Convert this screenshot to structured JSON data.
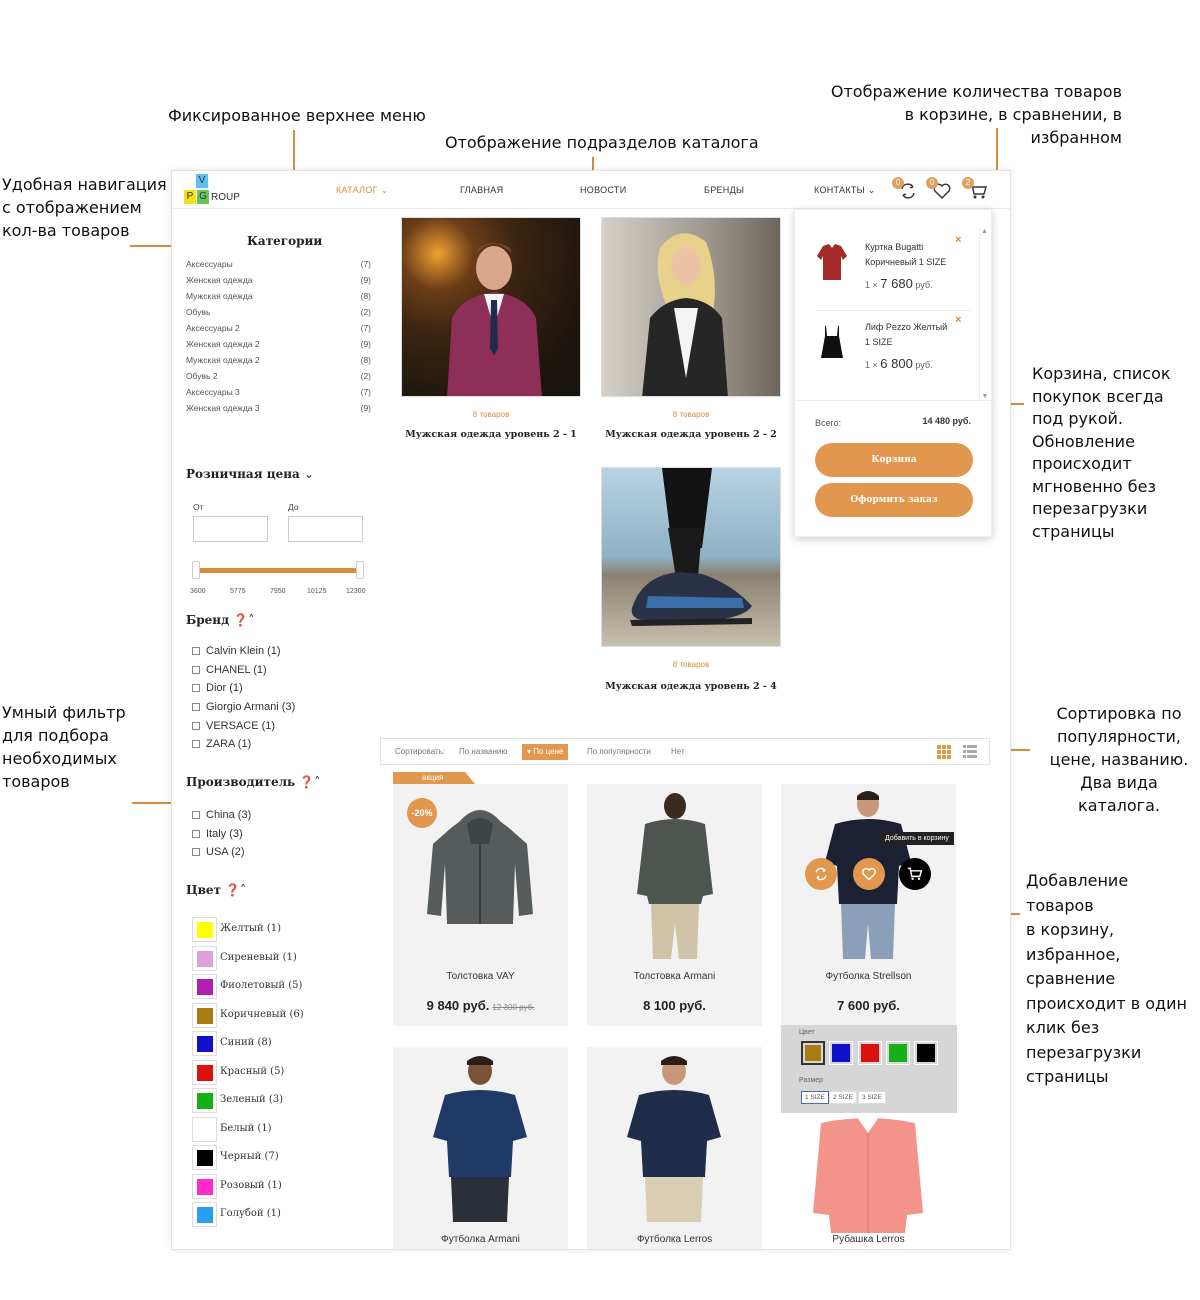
{
  "annotations": {
    "fixed_menu": "Фиксированное верхнее меню",
    "subsections": "Отображение подразделов каталога",
    "counters": [
      "Отображение количества товаров",
      "в корзине, в сравнении, в избранном"
    ],
    "navigation": [
      "Удобная навигация",
      "с отображением",
      "кол-ва товаров"
    ],
    "cart": [
      "Корзина, список",
      "покупок всегда",
      "под рукой.",
      "Обновление",
      "происходит",
      "мгновенно без",
      "перезагрузки",
      "страницы"
    ],
    "smart_filter": [
      "Умный фильтр",
      "для подбора",
      "необходимых",
      "товаров"
    ],
    "sorting": [
      "Сортировка по",
      "популярности,",
      "цене, названию.",
      "Два вида каталога."
    ],
    "add_to": [
      "Добавление товаров",
      "в корзину,",
      "избранное,",
      "сравнение",
      "происходит в один",
      "клик без",
      "перезагрузки",
      "страницы"
    ]
  },
  "logo": {
    "letters": [
      "V",
      "P",
      "G"
    ],
    "text": "ROUP"
  },
  "nav": {
    "catalog": "КАТАЛОГ",
    "home": "ГЛАВНАЯ",
    "news": "НОВОСТИ",
    "brands": "БРЕНДЫ",
    "contacts": "КОНТАКТЫ"
  },
  "counters": {
    "compare": "0",
    "favorites": "0",
    "cart": "2"
  },
  "sidebar": {
    "categories_title": "Категории",
    "categories": [
      {
        "name": "Аксессуары",
        "count": "(7)"
      },
      {
        "name": "Женская одежда",
        "count": "(9)"
      },
      {
        "name": "Мужская одежда",
        "count": "(8)"
      },
      {
        "name": "Обувь",
        "count": "(2)"
      },
      {
        "name": "Аксессуары 2",
        "count": "(7)"
      },
      {
        "name": "Женская одежда 2",
        "count": "(9)"
      },
      {
        "name": "Мужская одежда 2",
        "count": "(8)"
      },
      {
        "name": "Обувь 2",
        "count": "(2)"
      },
      {
        "name": "Аксессуары 3",
        "count": "(7)"
      },
      {
        "name": "Женская одежда 3",
        "count": "(9)"
      }
    ],
    "price_title": "Розничная цена",
    "price_from": "От",
    "price_to": "До",
    "price_ticks": [
      "3600",
      "5775",
      "7950",
      "10125",
      "12300"
    ],
    "brand_title": "Бренд",
    "brands": [
      "Calvin Klein (1)",
      "CHANEL (1)",
      "Dior (1)",
      "Giorgio Armani (3)",
      "VERSACE (1)",
      "ZARA (1)"
    ],
    "maker_title": "Производитель",
    "makers": [
      "China (3)",
      "Italy (3)",
      "USA (2)"
    ],
    "color_title": "Цвет",
    "colors": [
      {
        "name": "Желтый (1)",
        "hex": "#ffff00"
      },
      {
        "name": "Сиреневый (1)",
        "hex": "#dda0dd"
      },
      {
        "name": "Фиолетовый (5)",
        "hex": "#b01fb0"
      },
      {
        "name": "Коричневый (6)",
        "hex": "#a97b10"
      },
      {
        "name": "Синий (8)",
        "hex": "#1010c8"
      },
      {
        "name": "Красный (5)",
        "hex": "#dd1010"
      },
      {
        "name": "Зеленый (3)",
        "hex": "#18b018"
      },
      {
        "name": "Белый (1)",
        "hex": "#ffffff"
      },
      {
        "name": "Черный (7)",
        "hex": "#000000"
      },
      {
        "name": "Розовый (1)",
        "hex": "#ff2cc8"
      },
      {
        "name": "Голубой (1)",
        "hex": "#2a9ef0"
      }
    ]
  },
  "subsections": [
    {
      "count": "8 товаров",
      "name": "Мужская одежда уровень 2 - 1"
    },
    {
      "count": "8 товаров",
      "name": "Мужская одежда уровень 2 - 2"
    },
    {
      "count": "8 товаров",
      "name": "Мужская одежда уровень 2 - 4"
    }
  ],
  "cart": {
    "items": [
      {
        "name1": "Куртка Bugatti",
        "name2": "Коричневый 1 SIZE",
        "qty": "1 ×",
        "price": "7 680",
        "cur": "руб."
      },
      {
        "name1": "Лиф Pezzo Желтый",
        "name2": "1 SIZE",
        "qty": "1 ×",
        "price": "6 800",
        "cur": "руб."
      }
    ],
    "total_label": "Всего:",
    "total": "14 480 руб.",
    "btn_cart": "Корзина",
    "btn_checkout": "Оформить заказ",
    "remove_icon": "×"
  },
  "sorting": {
    "label": "Сортировать:",
    "by_name": "По названию",
    "by_price": "По цене",
    "by_popularity": "По популярности",
    "none": "Нет"
  },
  "promo": "акция",
  "products": [
    {
      "name": "Толстовка VAY",
      "price": "9 840 руб.",
      "old": "12 300 руб.",
      "discount": "-20%"
    },
    {
      "name": "Толстовка Armani",
      "price": "8 100 руб."
    },
    {
      "name": "Футболка Strellson",
      "price": "7 600 руб."
    },
    {
      "name": "Футболка Armani"
    },
    {
      "name": "Футболка Lerros"
    },
    {
      "name": "Рубашка Lerros"
    }
  ],
  "add_to_cart_tooltip": "Добавить в корзину",
  "options": {
    "color_label": "Цвет",
    "size_label": "Размер",
    "colors": [
      "#a97b10",
      "#1010c8",
      "#dd1010",
      "#18b018",
      "#000000"
    ],
    "sizes": [
      "1 SIZE",
      "2 SIZE",
      "3 SIZE"
    ]
  }
}
